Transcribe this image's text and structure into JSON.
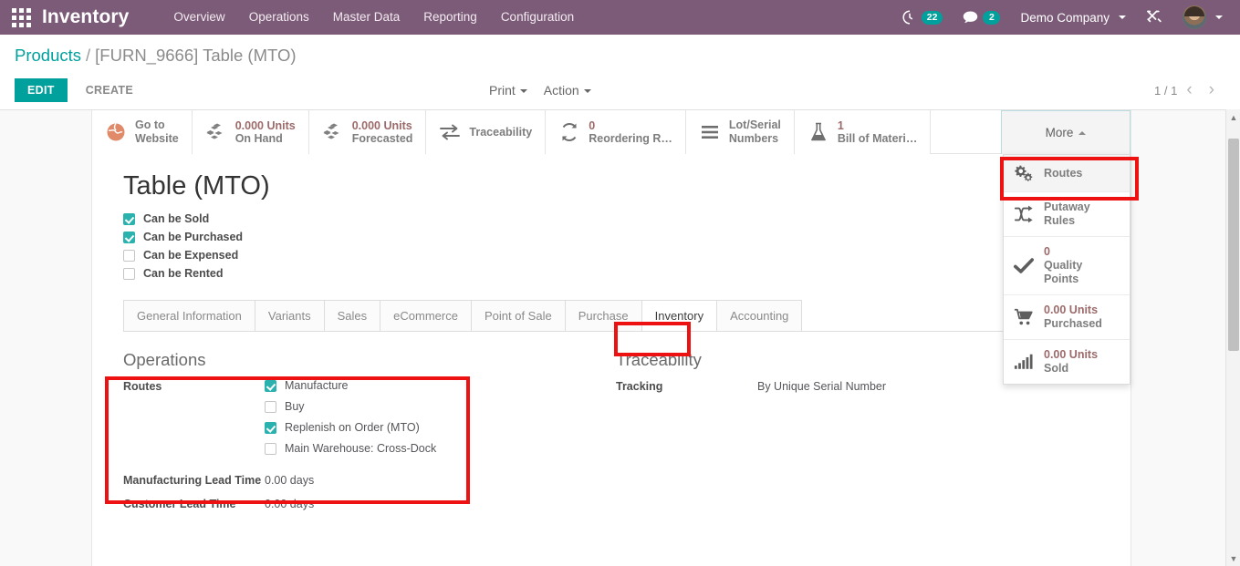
{
  "navbar": {
    "apps_icon": "apps-grid-icon",
    "brand": "Inventory",
    "menu": [
      {
        "label": "Overview"
      },
      {
        "label": "Operations"
      },
      {
        "label": "Master Data"
      },
      {
        "label": "Reporting"
      },
      {
        "label": "Configuration"
      }
    ],
    "activities": {
      "icon": "clock-icon",
      "count": "22"
    },
    "messages": {
      "icon": "chat-icon",
      "count": "2"
    },
    "company": "Demo Company",
    "debug_icon": "tools-icon",
    "avatar": "user-avatar",
    "accent": "#7c5b78",
    "badge_color": "#00A09D"
  },
  "control_panel": {
    "breadcrumb_root": "Products",
    "breadcrumb_sep": "/",
    "breadcrumb_current": "[FURN_9666] Table (MTO)",
    "edit_label": "EDIT",
    "create_label": "CREATE",
    "print_label": "Print",
    "action_label": "Action",
    "pager_value": "1 / 1",
    "pager_prev": "‹",
    "pager_next": "›",
    "accent": "#00A09D"
  },
  "stat_buttons": [
    {
      "icon": "globe-icon",
      "value": "",
      "label": "Go to",
      "label2": "Website"
    },
    {
      "icon": "cubes-icon",
      "value": "0.000 Units",
      "label": "On Hand",
      "label2": ""
    },
    {
      "icon": "cubes-icon",
      "value": "0.000 Units",
      "label": "Forecasted",
      "label2": ""
    },
    {
      "icon": "exchange-icon",
      "value": "",
      "label": "Traceability",
      "label2": ""
    },
    {
      "icon": "refresh-icon",
      "value": "0",
      "label": "Reordering R…",
      "label2": ""
    },
    {
      "icon": "bars-icon",
      "value": "",
      "label": "Lot/Serial",
      "label2": "Numbers"
    },
    {
      "icon": "flask-icon",
      "value": "1",
      "label": "Bill of Materi…",
      "label2": ""
    }
  ],
  "more_button": {
    "label": "More",
    "caret": "caret-up-icon"
  },
  "more_menu": [
    {
      "icon": "gears-icon",
      "value": "",
      "label": "Routes"
    },
    {
      "icon": "shuffle-icon",
      "value": "",
      "label": "Putaway Rules"
    },
    {
      "icon": "check-icon",
      "value": "0",
      "label": "Quality Points"
    },
    {
      "icon": "cart-icon",
      "value": "0.00 Units",
      "label": "Purchased"
    },
    {
      "icon": "barchart-icon",
      "value": "0.00 Units",
      "label": "Sold"
    }
  ],
  "product": {
    "title": "Table (MTO)",
    "flags": [
      {
        "label": "Can be Sold",
        "checked": true
      },
      {
        "label": "Can be Purchased",
        "checked": true
      },
      {
        "label": "Can be Expensed",
        "checked": false
      },
      {
        "label": "Can be Rented",
        "checked": false
      }
    ]
  },
  "tabs": [
    {
      "label": "General Information",
      "active": false
    },
    {
      "label": "Variants",
      "active": false
    },
    {
      "label": "Sales",
      "active": false
    },
    {
      "label": "eCommerce",
      "active": false
    },
    {
      "label": "Point of Sale",
      "active": false
    },
    {
      "label": "Purchase",
      "active": false
    },
    {
      "label": "Inventory",
      "active": true
    },
    {
      "label": "Accounting",
      "active": false
    }
  ],
  "inventory_tab": {
    "operations_title": "Operations",
    "routes_label": "Routes",
    "routes": [
      {
        "label": "Manufacture",
        "checked": true
      },
      {
        "label": "Buy",
        "checked": false
      },
      {
        "label": "Replenish on Order (MTO)",
        "checked": true
      },
      {
        "label": "Main Warehouse: Cross-Dock",
        "checked": false
      }
    ],
    "manufacturing_lead_label": "Manufacturing Lead Time",
    "manufacturing_lead_value": "0.00 days",
    "customer_lead_label": "Customer Lead Time",
    "customer_lead_value": "0.00 days",
    "traceability_title": "Traceability",
    "tracking_label": "Tracking",
    "tracking_value": "By Unique Serial Number"
  },
  "annotations": {
    "color": "#ee1111",
    "boxes": [
      "routes-menu-item",
      "inventory-tab",
      "operations-routes-section"
    ]
  }
}
